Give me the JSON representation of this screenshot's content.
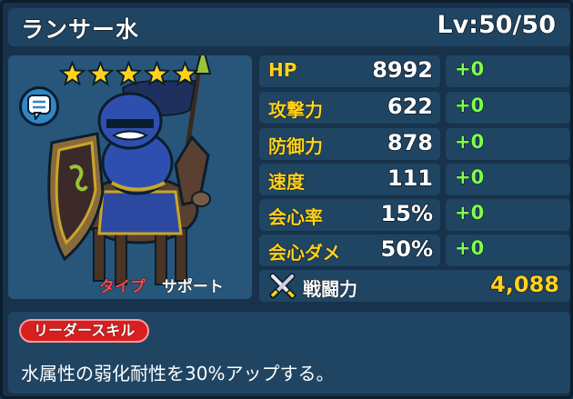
{
  "header": {
    "name": "ランサー水",
    "level": "Lv:50/50"
  },
  "portrait": {
    "star_count": 5,
    "star_color": "#ffd21c",
    "chat_icon": "chat-bubble-icon",
    "type_label": "タイプ",
    "type_value": "サポート"
  },
  "stats": [
    {
      "label": "HP",
      "value": "8992",
      "bonus": "+0"
    },
    {
      "label": "攻撃力",
      "value": "622",
      "bonus": "+0"
    },
    {
      "label": "防御力",
      "value": "878",
      "bonus": "+0"
    },
    {
      "label": "速度",
      "value": "111",
      "bonus": "+0"
    },
    {
      "label": "会心率",
      "value": "15%",
      "bonus": "+0"
    },
    {
      "label": "会心ダメ",
      "value": "50%",
      "bonus": "+0"
    }
  ],
  "power": {
    "icon": "crossed-swords-icon",
    "label": "戦闘力",
    "value": "4,088"
  },
  "skill": {
    "badge": "リーダースキル",
    "text": "水属性の弱化耐性を30%アップする。"
  },
  "colors": {
    "stat_label": "#ffd21c",
    "bonus": "#7fff4e",
    "badge": "#d71f1f",
    "type_label": "#ff4a4a"
  }
}
